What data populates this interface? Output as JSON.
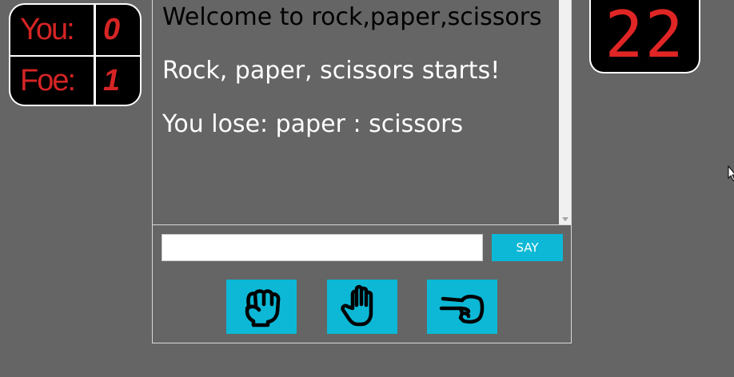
{
  "scoreboard": {
    "you_label": "You:",
    "you_score": "0",
    "foe_label": "Foe:",
    "foe_score": "1"
  },
  "timer": {
    "value": "22"
  },
  "chat": {
    "messages": [
      "Welcome to rock,paper,scissors",
      "Rock, paper, scissors starts!",
      "You lose: paper : scissors"
    ],
    "input_value": "",
    "input_placeholder": "",
    "say_label": "SAY"
  },
  "moves": [
    {
      "icon": "hand-rock-icon"
    },
    {
      "icon": "hand-paper-icon"
    },
    {
      "icon": "hand-scissors-icon"
    }
  ],
  "colors": {
    "background": "#656565",
    "accent": "#0cb8d6",
    "led_red": "#d62424",
    "panel_black": "#000000"
  }
}
